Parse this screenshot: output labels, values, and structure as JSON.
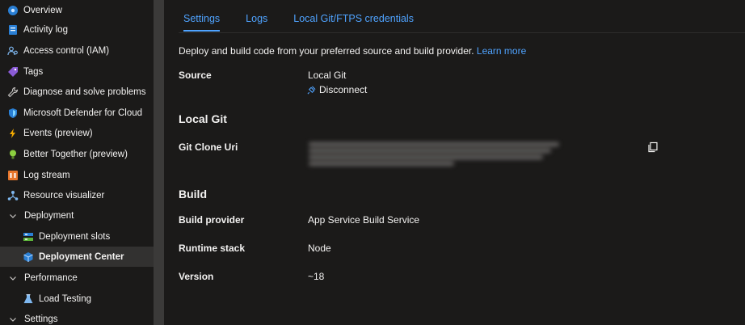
{
  "sidebar": {
    "items": [
      {
        "label": "Overview",
        "icon": "overview-icon"
      },
      {
        "label": "Activity log",
        "icon": "activity-log-icon"
      },
      {
        "label": "Access control (IAM)",
        "icon": "iam-icon"
      },
      {
        "label": "Tags",
        "icon": "tag-icon"
      },
      {
        "label": "Diagnose and solve problems",
        "icon": "wrench-icon"
      },
      {
        "label": "Microsoft Defender for Cloud",
        "icon": "shield-icon"
      },
      {
        "label": "Events (preview)",
        "icon": "lightning-icon"
      },
      {
        "label": "Better Together (preview)",
        "icon": "lightbulb-icon"
      },
      {
        "label": "Log stream",
        "icon": "log-stream-icon"
      },
      {
        "label": "Resource visualizer",
        "icon": "network-icon"
      },
      {
        "label": "Deployment",
        "icon": "chevron-down-icon"
      },
      {
        "label": "Deployment slots",
        "icon": "slots-icon"
      },
      {
        "label": "Deployment Center",
        "icon": "cube-icon"
      },
      {
        "label": "Performance",
        "icon": "chevron-down-icon"
      },
      {
        "label": "Load Testing",
        "icon": "flask-icon"
      },
      {
        "label": "Settings",
        "icon": "chevron-down-icon"
      }
    ]
  },
  "tabs": [
    "Settings",
    "Logs",
    "Local Git/FTPS credentials"
  ],
  "intro": {
    "text": "Deploy and build code from your preferred source and build provider.",
    "link": "Learn more"
  },
  "source": {
    "label": "Source",
    "value": "Local Git",
    "action": "Disconnect"
  },
  "local_git": {
    "heading": "Local Git",
    "clone_label": "Git Clone Uri"
  },
  "build": {
    "heading": "Build",
    "provider_label": "Build provider",
    "provider_value": "App Service Build Service",
    "stack_label": "Runtime stack",
    "stack_value": "Node",
    "version_label": "Version",
    "version_value": "~18"
  },
  "colors": {
    "accent": "#4fa3ff",
    "background": "#1b1a19",
    "selected": "#323130"
  }
}
